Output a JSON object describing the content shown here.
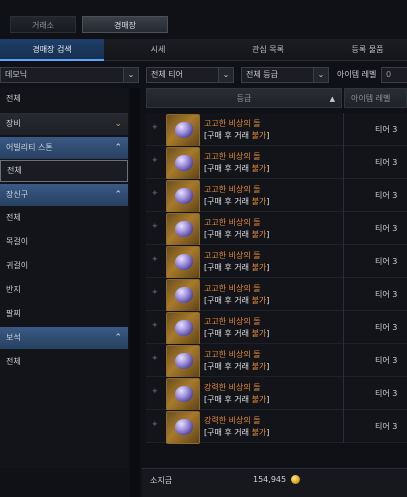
{
  "top_tabs": [
    "거래소",
    "경매장"
  ],
  "sub_tabs": [
    "경매장 검색",
    "시세",
    "관심 목록",
    "등록 물품"
  ],
  "filters": {
    "category": "데모닉",
    "tier": "전체 티어",
    "grade": "전체 등급",
    "item_level_label": "아이템 레벨",
    "item_level_value": "0"
  },
  "sidebar": {
    "all": "전체",
    "equipment": "장비",
    "ability_stone": "어빌리티 스톤",
    "ability_stone_all": "전체",
    "accessory": "장신구",
    "acc_items": [
      "전체",
      "목걸이",
      "귀걸이",
      "반지",
      "팔찌"
    ],
    "gem": "보석",
    "gem_all": "전체"
  },
  "table_header": {
    "grade": "등급",
    "item_level": "아이템 레벨"
  },
  "rows": [
    {
      "name": "고고한 비상의 돌",
      "bind_prefix": "[구매 후 거래 ",
      "bind_status": "불가",
      "bind_suffix": "]",
      "tier": "티어 3"
    },
    {
      "name": "고고한 비상의 돌",
      "bind_prefix": "[구매 후 거래 ",
      "bind_status": "불가",
      "bind_suffix": "]",
      "tier": "티어 3"
    },
    {
      "name": "고고한 비상의 돌",
      "bind_prefix": "[구매 후 거래 ",
      "bind_status": "불가",
      "bind_suffix": "]",
      "tier": "티어 3"
    },
    {
      "name": "고고한 비상의 돌",
      "bind_prefix": "[구매 후 거래 ",
      "bind_status": "불가",
      "bind_suffix": "]",
      "tier": "티어 3"
    },
    {
      "name": "고고한 비상의 돌",
      "bind_prefix": "[구매 후 거래 ",
      "bind_status": "불가",
      "bind_suffix": "]",
      "tier": "티어 3"
    },
    {
      "name": "고고한 비상의 돌",
      "bind_prefix": "[구매 후 거래 ",
      "bind_status": "불가",
      "bind_suffix": "]",
      "tier": "티어 3"
    },
    {
      "name": "고고한 비상의 돌",
      "bind_prefix": "[구매 후 거래 ",
      "bind_status": "불가",
      "bind_suffix": "]",
      "tier": "티어 3"
    },
    {
      "name": "고고한 비상의 돌",
      "bind_prefix": "[구매 후 거래 ",
      "bind_status": "불가",
      "bind_suffix": "]",
      "tier": "티어 3"
    },
    {
      "name": "강력한 비상의 돌",
      "bind_prefix": "[구매 후 거래 ",
      "bind_status": "불가",
      "bind_suffix": "]",
      "tier": "티어 3"
    },
    {
      "name": "강력한 비상의 돌",
      "bind_prefix": "[구매 후 거래 ",
      "bind_status": "불가",
      "bind_suffix": "]",
      "tier": "티어 3"
    }
  ],
  "gold": {
    "label": "소지금",
    "amount": "154,945"
  }
}
